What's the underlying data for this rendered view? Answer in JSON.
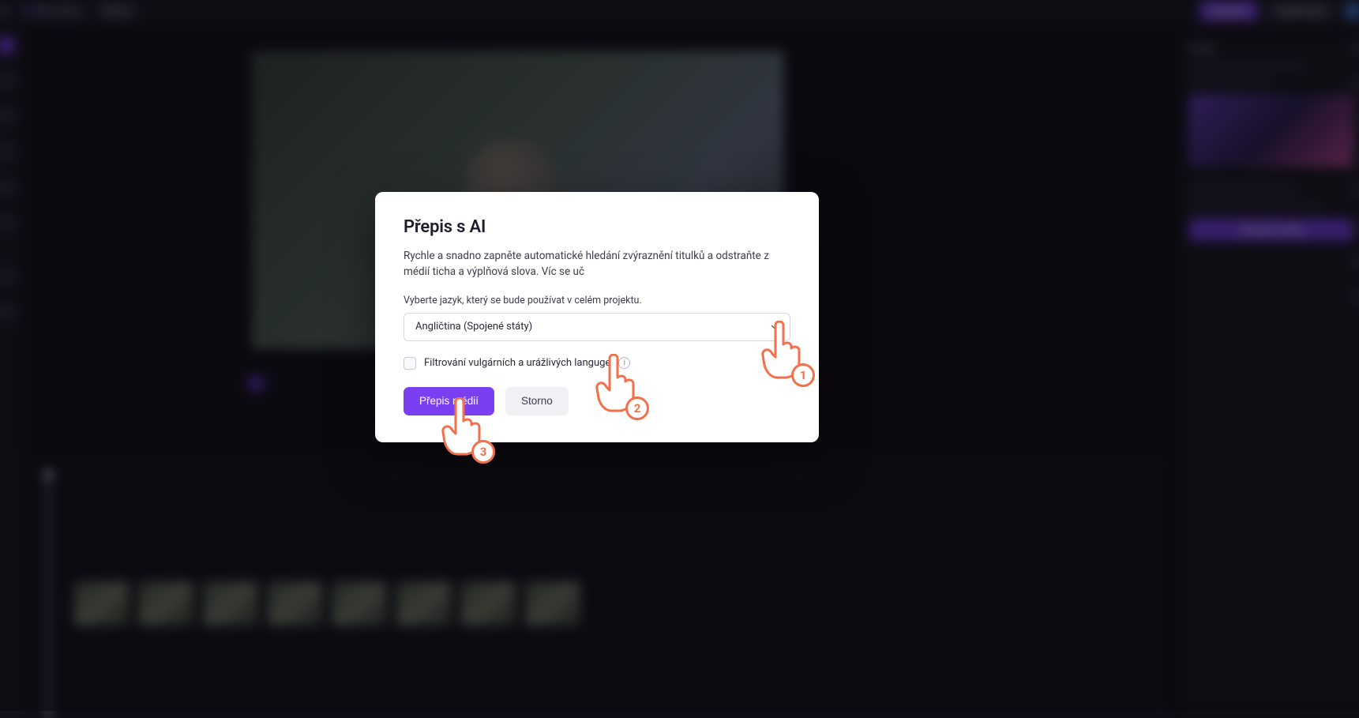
{
  "topbar": {
    "project_name": "Bez názvu",
    "tag": "Návrh",
    "upgrade_label": "Upgrade",
    "export_label": "Exportovat"
  },
  "right_panel": {
    "header": "Přepis",
    "cta_label": "Přepsat média"
  },
  "modal": {
    "title": "Přepis s AI",
    "description": "Rychle a snadno zapněte automatické hledání zvýraznění titulků a odstraňte z médií ticha a výplňová slova.",
    "learn_more": "Víc se uč",
    "language_field_label": "Vyberte jazyk, který se bude používat v celém projektu.",
    "language_selected": "Angličtina (Spojené státy)",
    "checkbox_label": "Filtrování vulgárních a urážlivých languge",
    "primary_button": "Přepis médií",
    "secondary_button": "Storno"
  },
  "annotations": {
    "one": "1",
    "two": "2",
    "three": "3"
  },
  "timeline_marks": [
    "",
    "",
    "",
    "",
    "",
    "",
    "",
    "",
    "",
    "",
    "",
    "",
    "",
    "",
    "",
    "",
    "",
    ""
  ],
  "colors": {
    "accent": "#7b3ff2",
    "annotation": "#f0714b"
  }
}
